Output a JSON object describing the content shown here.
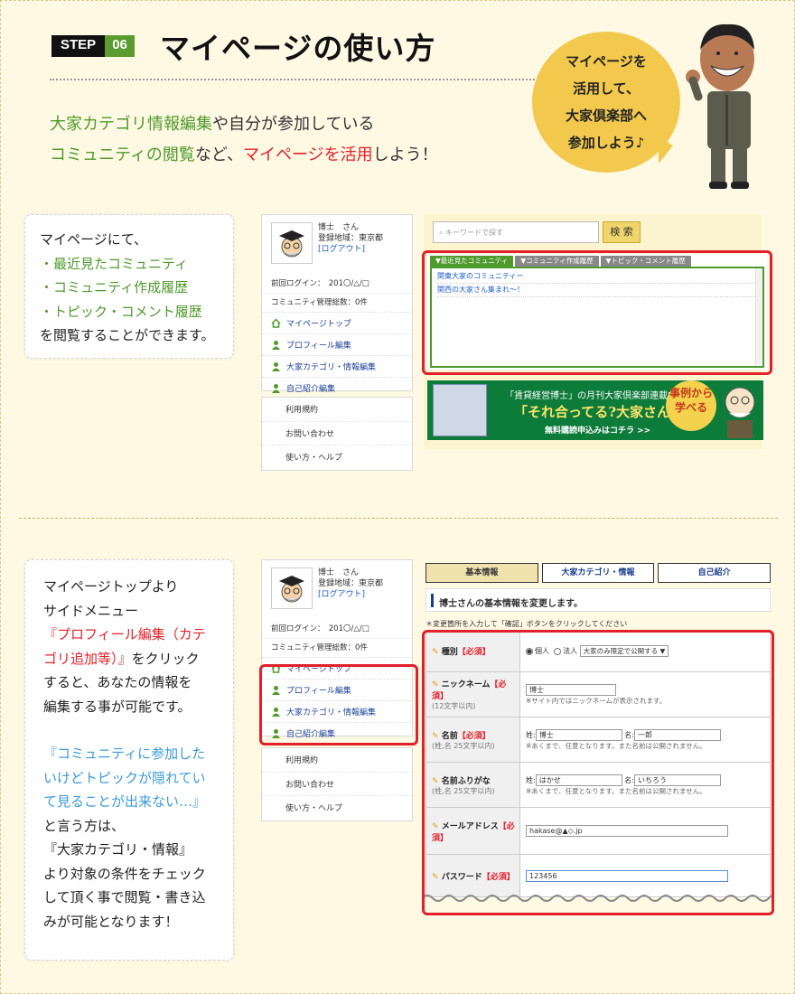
{
  "header": {
    "step_label": "STEP",
    "step_number": "06",
    "title": "マイページの使い方"
  },
  "intro": {
    "line1_green": "大家カテゴリ情報編集",
    "line1_rest": "や自分が参加している",
    "line2_green": "コミュニティの閲覧",
    "line2_mid": "など、",
    "line2_red": "マイページを活用",
    "line2_end": "しよう！"
  },
  "bubble": {
    "line1": "マイページを",
    "line2": "活用して、",
    "line3": "大家倶楽部へ",
    "line4": "参加しよう♪"
  },
  "section1": {
    "desc": {
      "l1": "マイページにて、",
      "l2": "・最近見たコミュニティ",
      "l3": "・コミュニティ作成履歴",
      "l4": "・トピック・コメント履歴",
      "l5": "を閲覧することができます。"
    },
    "search_placeholder": "キーワードで探す",
    "search_button": "検 索",
    "tabs": [
      "▼最近見たコミュニティ",
      "▼コミュニティ作成履歴",
      "▼トピック・コメント履歴"
    ],
    "community_items": [
      "関東大家のコミュニティー",
      "関西の大家さん集まれ〜！"
    ],
    "banner": {
      "line1": "「賃貸経営博士」の月刊大家倶楽部連載中",
      "line2": "「それ合ってる?大家さん」",
      "line3": "無料購読申込みはコチラ >>",
      "stamp1": "事例から",
      "stamp2": "学べる"
    }
  },
  "sidebar": {
    "user_name": "博士　さん",
    "region": "登録地域：東京都",
    "logout": "[ログアウト]",
    "last_login": "前回ログイン：　201〇/△/□",
    "communities": "コミュニティ管理総数：0件",
    "menu": [
      "マイページトップ",
      "プロフィール編集",
      "大家カテゴリ・情報編集",
      "自己紹介編集"
    ],
    "links": [
      "利用規約",
      "お問い合わせ",
      "使い方・ヘルプ"
    ]
  },
  "section2": {
    "desc": {
      "l1": "マイページトップより",
      "l2": "サイドメニュー",
      "l3": "『プロフィール編集（カテ",
      "l4": "ゴリ追加等）』",
      "l4b": "をクリック",
      "l5": "すると、あなたの情報を",
      "l6": "編集する事が可能です。",
      "l7": "『コミュニティに参加した",
      "l8": "いけどトピックが隠れてい",
      "l9": "て見ることが出来ない…』",
      "l10": "と言う方は、",
      "l11": "『大家カテゴリ・情報』",
      "l12": "より対象の条件をチェック",
      "l13": "して頂く事で閲覧・書き込",
      "l14": "みが可能となります！"
    },
    "form_tabs": [
      "基本情報",
      "大家カテゴリ・情報",
      "自己紹介"
    ],
    "form_heading": "博士さんの基本情報を変更します。",
    "form_note": "＊変更箇所を入力して「確認」ボタンをクリックしてください",
    "required": "【必須】",
    "rows": {
      "kind": {
        "label": "種別",
        "opt1": "個人",
        "opt2": "法人",
        "select": "大家のみ限定で公開する ▼"
      },
      "nickname": {
        "label": "ニックネーム",
        "sub": "(12文字以内)",
        "value": "博士",
        "note": "※サイト内ではニックネームが表示されます。"
      },
      "name": {
        "label": "名前",
        "sub": "(姓,名 25文字以内)",
        "sei_label": "姓:",
        "sei": "博士",
        "mei_label": "名:",
        "mei": "一郎",
        "note": "※あくまで、任意となります。また名前は公開されません。"
      },
      "kana": {
        "label": "名前ふりがな",
        "sub": "(姓,名 25文字以内)",
        "sei_label": "姓:",
        "sei": "はかせ",
        "mei_label": "名:",
        "mei": "いちろう",
        "note": "※あくまで、任意となります。また名前は公開されません。"
      },
      "mail": {
        "label": "メールアドレス",
        "value": "hakase@▲◇.jp"
      },
      "password": {
        "label": "パスワード",
        "value": "123456"
      }
    }
  },
  "colors": {
    "accent_green": "#4e9a2c",
    "accent_red": "#e2202b",
    "accent_blue": "#3a9ad9",
    "bubble": "#f2c94c"
  }
}
